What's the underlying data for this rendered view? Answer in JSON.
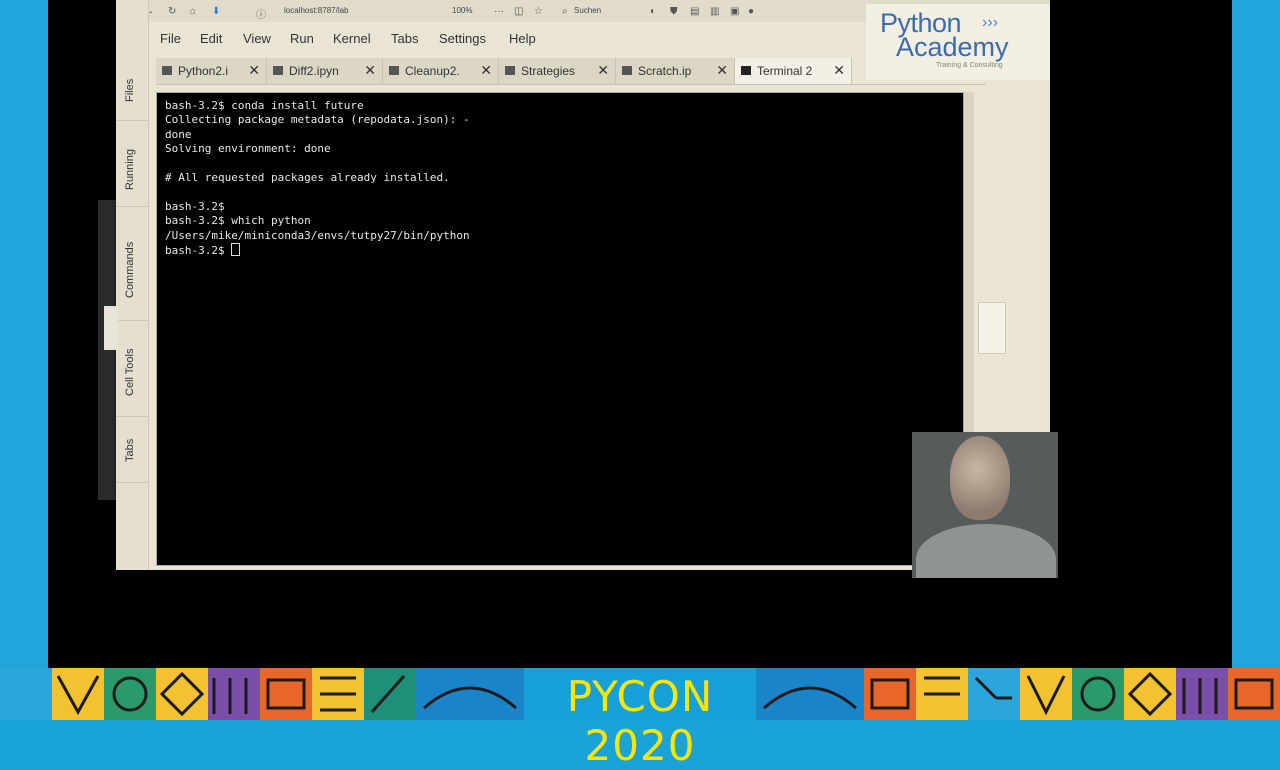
{
  "browser": {
    "url": "localhost:8787/lab",
    "zoom": "100%",
    "search_placeholder": "Suchen"
  },
  "menu": [
    "File",
    "Edit",
    "View",
    "Run",
    "Kernel",
    "Tabs",
    "Settings",
    "Help"
  ],
  "tabs": [
    {
      "label": "Python2.i",
      "active": false
    },
    {
      "label": "Diff2.ipyn",
      "active": false
    },
    {
      "label": "Cleanup2.",
      "active": false
    },
    {
      "label": "Strategies",
      "active": false
    },
    {
      "label": "Scratch.ip",
      "active": false
    },
    {
      "label": "Terminal 2",
      "active": true
    }
  ],
  "sidebar": [
    "Files",
    "Running",
    "Commands",
    "Cell Tools",
    "Tabs"
  ],
  "terminal": {
    "lines": [
      "bash-3.2$ conda install future",
      "Collecting package metadata (repodata.json): -",
      "done",
      "Solving environment: done",
      "",
      "# All requested packages already installed.",
      "",
      "bash-3.2$",
      "bash-3.2$ which python",
      "/Users/mike/miniconda3/envs/tutpy27/bin/python",
      "bash-3.2$ "
    ]
  },
  "logo": {
    "line1": "Python",
    "line2": "Academy",
    "sub": "Training & Consulting"
  },
  "banner": {
    "title": "PYCON 2020"
  },
  "colors": {
    "accent": "#17a0d8",
    "banner_text": "#ffe600",
    "logo": "#3b6cb0"
  }
}
